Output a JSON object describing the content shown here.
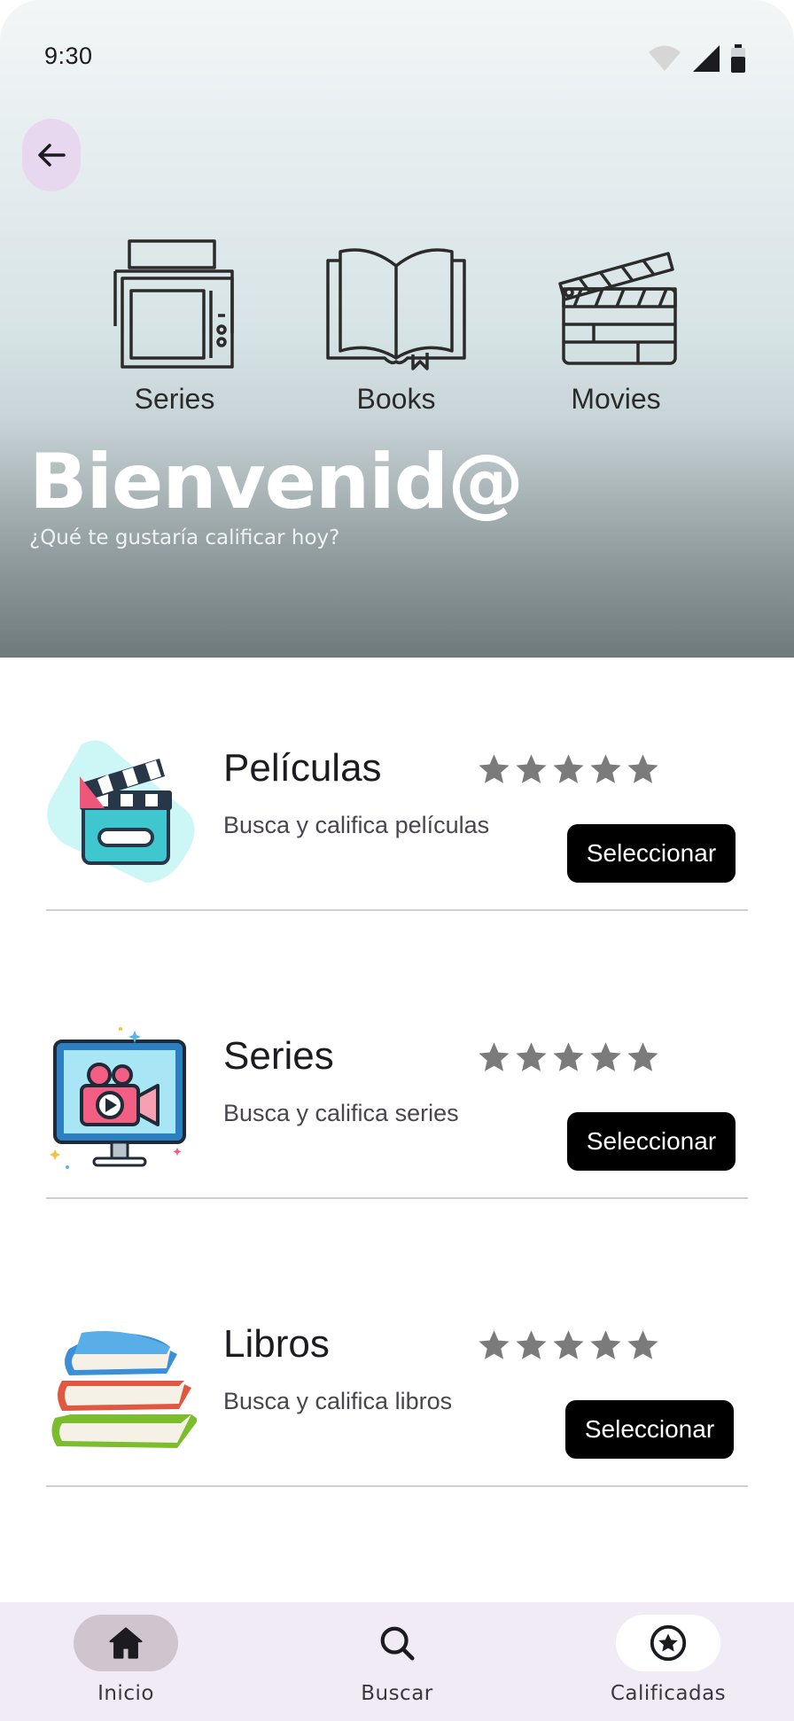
{
  "status_bar": {
    "time": "9:30",
    "icons": [
      "wifi-icon",
      "signal-icon",
      "battery-icon"
    ]
  },
  "header": {
    "back_icon": "arrow-left-icon",
    "categories": [
      {
        "label": "Series",
        "icon": "tv-devices-icon"
      },
      {
        "label": "Books",
        "icon": "open-book-icon"
      },
      {
        "label": "Movies",
        "icon": "clapperboard-icon"
      }
    ],
    "title": "Bienvenid@",
    "subtitle": "¿Qué te gustaría calificar hoy?"
  },
  "cards": [
    {
      "title": "Películas",
      "description": "Busca y califica películas",
      "button": "Seleccionar",
      "rating": 5,
      "icon": "movie-clapper-icon"
    },
    {
      "title": "Series",
      "description": "Busca y califica series",
      "button": "Seleccionar",
      "rating": 5,
      "icon": "tv-video-icon"
    },
    {
      "title": "Libros",
      "description": "Busca y califica libros",
      "button": "Seleccionar",
      "rating": 5,
      "icon": "books-stack-icon"
    }
  ],
  "bottom_nav": {
    "items": [
      {
        "label": "Inicio",
        "icon": "home-icon",
        "active": true
      },
      {
        "label": "Buscar",
        "icon": "search-icon",
        "active": false
      },
      {
        "label": "Calificadas",
        "icon": "star-circle-icon",
        "active": false
      }
    ]
  },
  "colors": {
    "accent_pill": "#e8d8ef",
    "nav_background": "#f1ebf6",
    "active_pill": "#cfc5cf",
    "button": "#000000",
    "star": "#7b7b7b"
  }
}
